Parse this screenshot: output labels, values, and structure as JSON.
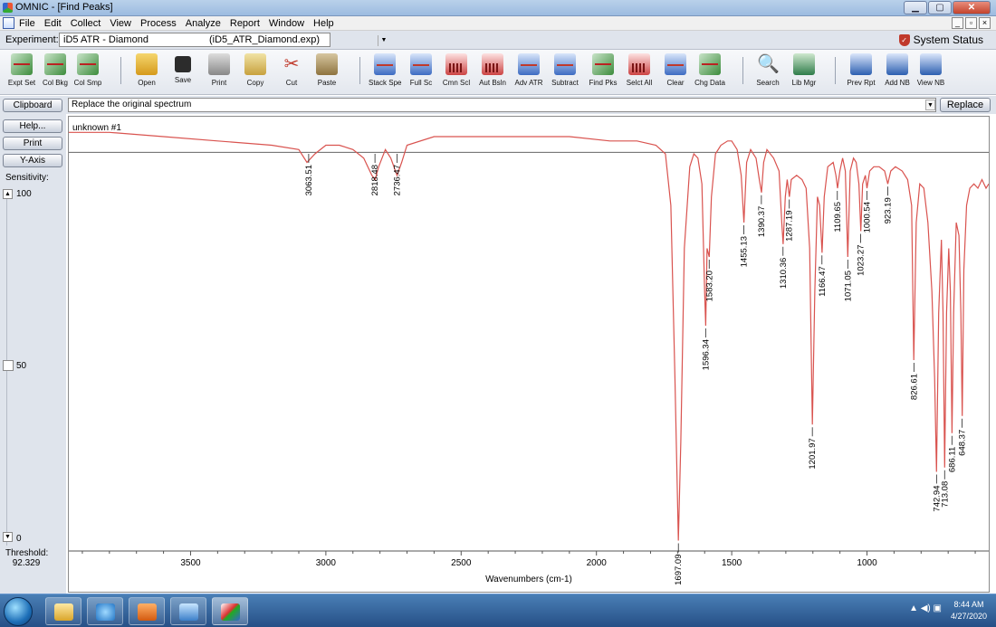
{
  "window": {
    "title": "OMNIC - [Find Peaks]",
    "min": "▁",
    "max": "▢",
    "close": "✕"
  },
  "menu": [
    "File",
    "Edit",
    "Collect",
    "View",
    "Process",
    "Analyze",
    "Report",
    "Window",
    "Help"
  ],
  "mdi": [
    "_",
    "▫",
    "×"
  ],
  "experiment": {
    "label": "Experiment:",
    "name": "iD5 ATR - Diamond",
    "file": "(iD5_ATR_Diamond.exp)",
    "dropdown": "▼",
    "status": "System Status"
  },
  "toolbar": [
    {
      "label": "Expt Set",
      "icon": "spectrum-settings-icon",
      "cls": "spec"
    },
    {
      "label": "Col Bkg",
      "icon": "collect-background-icon",
      "cls": "spec"
    },
    {
      "label": "Col Smp",
      "icon": "collect-sample-icon",
      "cls": "spec"
    },
    {
      "label": "Open",
      "icon": "open-folder-icon",
      "cls": "folder"
    },
    {
      "label": "Save",
      "icon": "save-disk-icon",
      "cls": "disk"
    },
    {
      "label": "Print",
      "icon": "printer-icon",
      "cls": "printer"
    },
    {
      "label": "Copy",
      "icon": "copy-icon",
      "cls": "copy"
    },
    {
      "label": "Cut",
      "icon": "scissors-icon",
      "cls": "cut",
      "glyph": "✂"
    },
    {
      "label": "Paste",
      "icon": "paste-icon",
      "cls": "paste"
    },
    {
      "label": "Stack Spe",
      "icon": "stack-spectra-icon",
      "cls": "view"
    },
    {
      "label": "Full Sc",
      "icon": "full-scale-icon",
      "cls": "view"
    },
    {
      "label": "Cmn Scl",
      "icon": "common-scale-icon",
      "cls": "bars"
    },
    {
      "label": "Aut Bsln",
      "icon": "auto-baseline-icon",
      "cls": "bars"
    },
    {
      "label": "Adv ATR",
      "icon": "advanced-atr-icon",
      "cls": "view"
    },
    {
      "label": "Subtract",
      "icon": "subtract-icon",
      "cls": "view"
    },
    {
      "label": "Find Pks",
      "icon": "find-peaks-icon",
      "cls": "spec"
    },
    {
      "label": "Selct All",
      "icon": "select-all-icon",
      "cls": "bars"
    },
    {
      "label": "Clear",
      "icon": "clear-icon",
      "cls": "view"
    },
    {
      "label": "Chg Data",
      "icon": "change-data-icon",
      "cls": "spec"
    },
    {
      "label": "Search",
      "icon": "search-magnifier-icon",
      "cls": "find",
      "glyph": "🔍"
    },
    {
      "label": "Lib Mgr",
      "icon": "library-manager-icon",
      "cls": "lib"
    },
    {
      "label": "Prev Rpt",
      "icon": "preview-report-icon",
      "cls": "rpt"
    },
    {
      "label": "Add NB",
      "icon": "add-notebook-icon",
      "cls": "rpt"
    },
    {
      "label": "View NB",
      "icon": "view-notebook-icon",
      "cls": "rpt"
    }
  ],
  "side": {
    "buttons": [
      "Clipboard",
      "Help...",
      "Print",
      "Y-Axis"
    ],
    "sensitivity": "Sensitivity:",
    "ticks": [
      "100",
      "50",
      "0"
    ],
    "threshold_label": "Threshold:",
    "threshold_value": "92.329",
    "up": "▲",
    "down": "▼"
  },
  "command": {
    "text": "Replace the original spectrum",
    "dropdown": "▼",
    "button": "Replace"
  },
  "chart_data": {
    "type": "line",
    "series": [
      {
        "name": "unknown #1"
      }
    ],
    "xlabel": "Wavenumbers (cm-1)",
    "xlim": [
      3950,
      550
    ],
    "x_reversed": true,
    "ylim": [
      0,
      100
    ],
    "xticks": [
      3500,
      3000,
      2500,
      2000,
      1500,
      1000
    ],
    "threshold": 92.329,
    "peaks": [
      {
        "x": 3063.51,
        "label": "3063.51",
        "y": 90
      },
      {
        "x": 2818.48,
        "label": "2818.48",
        "y": 86
      },
      {
        "x": 2736.47,
        "label": "2736.47",
        "y": 87
      },
      {
        "x": 1697.09,
        "label": "1697.09",
        "y": 2
      },
      {
        "x": 1596.34,
        "label": "1596.34",
        "y": 52
      },
      {
        "x": 1583.2,
        "label": "1583.20",
        "y": 68
      },
      {
        "x": 1455.13,
        "label": "1455.13",
        "y": 76
      },
      {
        "x": 1390.37,
        "label": "1390.37",
        "y": 83
      },
      {
        "x": 1310.36,
        "label": "1310.36",
        "y": 71
      },
      {
        "x": 1287.19,
        "label": "1287.19",
        "y": 82
      },
      {
        "x": 1201.97,
        "label": "1201.97",
        "y": 29
      },
      {
        "x": 1166.47,
        "label": "1166.47",
        "y": 69
      },
      {
        "x": 1109.65,
        "label": "1109.65",
        "y": 84
      },
      {
        "x": 1071.05,
        "label": "1071.05",
        "y": 68
      },
      {
        "x": 1023.27,
        "label": "1023.27",
        "y": 74
      },
      {
        "x": 1000.54,
        "label": "1000.54",
        "y": 84
      },
      {
        "x": 923.19,
        "label": "923.19",
        "y": 85
      },
      {
        "x": 826.61,
        "label": "826.61",
        "y": 44
      },
      {
        "x": 742.94,
        "label": "742.94",
        "y": 18
      },
      {
        "x": 713.08,
        "label": "713.08",
        "y": 19
      },
      {
        "x": 686.11,
        "label": "686.11",
        "y": 27
      },
      {
        "x": 648.37,
        "label": "648.37",
        "y": 31
      }
    ],
    "points": [
      [
        3950,
        97
      ],
      [
        3800,
        97
      ],
      [
        3600,
        96
      ],
      [
        3400,
        95
      ],
      [
        3200,
        94
      ],
      [
        3100,
        93
      ],
      [
        3070,
        90
      ],
      [
        3040,
        92
      ],
      [
        3000,
        94
      ],
      [
        2950,
        94
      ],
      [
        2900,
        93
      ],
      [
        2860,
        91
      ],
      [
        2830,
        87
      ],
      [
        2818,
        86
      ],
      [
        2805,
        89
      ],
      [
        2780,
        93
      ],
      [
        2760,
        91
      ],
      [
        2737,
        87
      ],
      [
        2720,
        90
      ],
      [
        2700,
        94
      ],
      [
        2600,
        96
      ],
      [
        2500,
        96
      ],
      [
        2300,
        96
      ],
      [
        2100,
        96
      ],
      [
        1950,
        95
      ],
      [
        1850,
        95
      ],
      [
        1780,
        94
      ],
      [
        1745,
        92
      ],
      [
        1725,
        80
      ],
      [
        1710,
        40
      ],
      [
        1697,
        2
      ],
      [
        1688,
        25
      ],
      [
        1675,
        70
      ],
      [
        1655,
        89
      ],
      [
        1640,
        92
      ],
      [
        1625,
        91
      ],
      [
        1610,
        85
      ],
      [
        1600,
        60
      ],
      [
        1596,
        52
      ],
      [
        1591,
        70
      ],
      [
        1583,
        68
      ],
      [
        1575,
        82
      ],
      [
        1560,
        92
      ],
      [
        1540,
        94
      ],
      [
        1515,
        95
      ],
      [
        1500,
        95
      ],
      [
        1480,
        93
      ],
      [
        1465,
        87
      ],
      [
        1455,
        76
      ],
      [
        1445,
        90
      ],
      [
        1430,
        93
      ],
      [
        1410,
        91
      ],
      [
        1398,
        86
      ],
      [
        1390,
        83
      ],
      [
        1382,
        90
      ],
      [
        1370,
        93
      ],
      [
        1345,
        91
      ],
      [
        1325,
        88
      ],
      [
        1315,
        76
      ],
      [
        1310,
        71
      ],
      [
        1302,
        82
      ],
      [
        1295,
        86
      ],
      [
        1287,
        82
      ],
      [
        1280,
        86
      ],
      [
        1260,
        87
      ],
      [
        1240,
        86
      ],
      [
        1225,
        84
      ],
      [
        1212,
        70
      ],
      [
        1202,
        29
      ],
      [
        1193,
        60
      ],
      [
        1183,
        82
      ],
      [
        1175,
        80
      ],
      [
        1166,
        69
      ],
      [
        1158,
        82
      ],
      [
        1145,
        89
      ],
      [
        1125,
        90
      ],
      [
        1115,
        87
      ],
      [
        1109,
        84
      ],
      [
        1100,
        88
      ],
      [
        1090,
        91
      ],
      [
        1080,
        88
      ],
      [
        1071,
        68
      ],
      [
        1062,
        88
      ],
      [
        1050,
        91
      ],
      [
        1040,
        90
      ],
      [
        1030,
        85
      ],
      [
        1023,
        74
      ],
      [
        1016,
        85
      ],
      [
        1006,
        87
      ],
      [
        1000,
        84
      ],
      [
        990,
        88
      ],
      [
        975,
        89
      ],
      [
        955,
        89
      ],
      [
        935,
        88
      ],
      [
        923,
        85
      ],
      [
        912,
        88
      ],
      [
        895,
        89
      ],
      [
        870,
        88
      ],
      [
        850,
        86
      ],
      [
        835,
        80
      ],
      [
        827,
        44
      ],
      [
        818,
        76
      ],
      [
        805,
        85
      ],
      [
        790,
        84
      ],
      [
        775,
        76
      ],
      [
        760,
        60
      ],
      [
        750,
        40
      ],
      [
        743,
        18
      ],
      [
        735,
        55
      ],
      [
        725,
        72
      ],
      [
        719,
        55
      ],
      [
        713,
        19
      ],
      [
        706,
        55
      ],
      [
        698,
        70
      ],
      [
        692,
        60
      ],
      [
        686,
        27
      ],
      [
        680,
        55
      ],
      [
        670,
        76
      ],
      [
        660,
        73
      ],
      [
        653,
        55
      ],
      [
        648,
        31
      ],
      [
        642,
        65
      ],
      [
        632,
        80
      ],
      [
        620,
        84
      ],
      [
        605,
        85
      ],
      [
        590,
        84
      ],
      [
        575,
        86
      ],
      [
        560,
        84
      ],
      [
        550,
        85
      ]
    ]
  },
  "taskbar": {
    "time": "8:44 AM",
    "date": "4/27/2020",
    "tray": "▲ ◀) ▣",
    "apps": [
      {
        "icon": "file-explorer-icon",
        "color": "linear-gradient(#ffe9a3,#d9a52a)"
      },
      {
        "icon": "internet-explorer-icon",
        "color": "radial-gradient(circle,#9fd9ff,#2376c6)"
      },
      {
        "icon": "media-player-icon",
        "color": "linear-gradient(#ffb066,#d35a10)"
      },
      {
        "icon": "windows-media-icon",
        "color": "linear-gradient(#c8e6ff,#3b7fc9)"
      },
      {
        "icon": "omnic-app-icon",
        "color": "linear-gradient(135deg,#fff,#d33 45%,#2a2 55%,#36c)"
      }
    ]
  }
}
